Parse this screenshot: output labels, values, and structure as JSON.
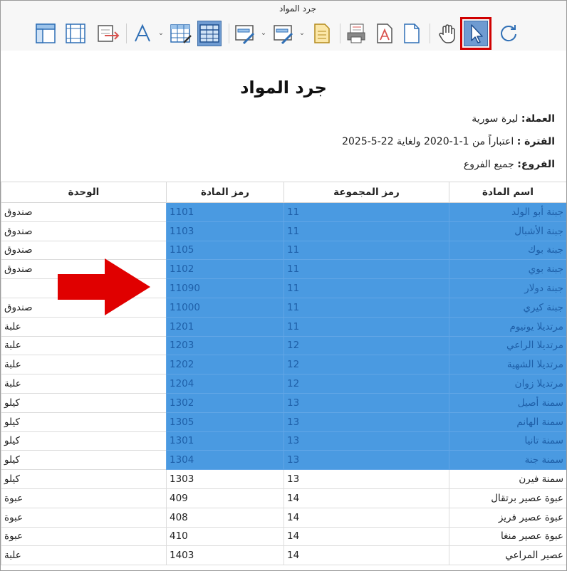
{
  "window": {
    "title": "جرد المواد"
  },
  "toolbar": {
    "icons": [
      "layout-icon",
      "columns-icon",
      "export-icon",
      "font-icon",
      "grid-format-icon",
      "grid-icon",
      "edit-form-icon",
      "edit-form2-icon",
      "document-icon",
      "print-preview-icon",
      "pdf-icon",
      "page-icon",
      "hand-tool-icon",
      "select-pointer-icon",
      "refresh-icon"
    ],
    "accent": "#6f9bd1",
    "highlight": "#d00000"
  },
  "report": {
    "title": "جرد المواد",
    "currency_label": "العملة:",
    "currency_value": "ليرة سورية",
    "period_label": "الفترة :",
    "period_value": "اعتباراً من 1-1-2020 ولغاية 22-5-2025",
    "branches_label": "الفروع:",
    "branches_value": "جميع الفروع"
  },
  "table": {
    "columns": [
      "اسم المادة",
      "رمز المجموعة",
      "رمز المادة",
      "الوحدة"
    ],
    "selection_color": "#4a9ae1",
    "rows": [
      {
        "name": "جبنة أبو الولد",
        "group": "11",
        "code": "1101",
        "unit": "صندوق",
        "selected": true
      },
      {
        "name": "جبنة الأشبال",
        "group": "11",
        "code": "1103",
        "unit": "صندوق",
        "selected": true
      },
      {
        "name": "جبنة بوك",
        "group": "11",
        "code": "1105",
        "unit": "صندوق",
        "selected": true
      },
      {
        "name": "جبنة بوي",
        "group": "11",
        "code": "1102",
        "unit": "صندوق",
        "selected": true
      },
      {
        "name": "جبنة دولار",
        "group": "11",
        "code": "11090",
        "unit": "",
        "selected": true
      },
      {
        "name": "جبنة كيري",
        "group": "11",
        "code": "11000",
        "unit": "صندوق",
        "selected": true
      },
      {
        "name": "مرتديلا يونيوم",
        "group": "11",
        "code": "1201",
        "unit": "علبة",
        "selected": true
      },
      {
        "name": "مرتديلا الراعي",
        "group": "12",
        "code": "1203",
        "unit": "علبة",
        "selected": true
      },
      {
        "name": "مرتديلا الشهية",
        "group": "12",
        "code": "1202",
        "unit": "علبة",
        "selected": true
      },
      {
        "name": "مرتديلا زوان",
        "group": "12",
        "code": "1204",
        "unit": "علبة",
        "selected": true
      },
      {
        "name": "سمنة أصيل",
        "group": "13",
        "code": "1302",
        "unit": "كيلو",
        "selected": true
      },
      {
        "name": "سمنة الهانم",
        "group": "13",
        "code": "1305",
        "unit": "كيلو",
        "selected": true
      },
      {
        "name": "سمنة تانيا",
        "group": "13",
        "code": "1301",
        "unit": "كيلو",
        "selected": true
      },
      {
        "name": "سمنة جنة",
        "group": "13",
        "code": "1304",
        "unit": "كيلو",
        "selected": true
      },
      {
        "name": "سمنة فيرن",
        "group": "13",
        "code": "1303",
        "unit": "كيلو",
        "selected": false
      },
      {
        "name": "عبوة عصير برتقال",
        "group": "14",
        "code": "409",
        "unit": "عبوة",
        "selected": false
      },
      {
        "name": "عبوة عصير فريز",
        "group": "14",
        "code": "408",
        "unit": "عبوة",
        "selected": false
      },
      {
        "name": "عبوة عصير منغا",
        "group": "14",
        "code": "410",
        "unit": "عبوة",
        "selected": false
      },
      {
        "name": "عصير المراعي",
        "group": "14",
        "code": "1403",
        "unit": "علبة",
        "selected": false
      }
    ]
  },
  "annotation": {
    "arrow_color": "#e00000"
  }
}
